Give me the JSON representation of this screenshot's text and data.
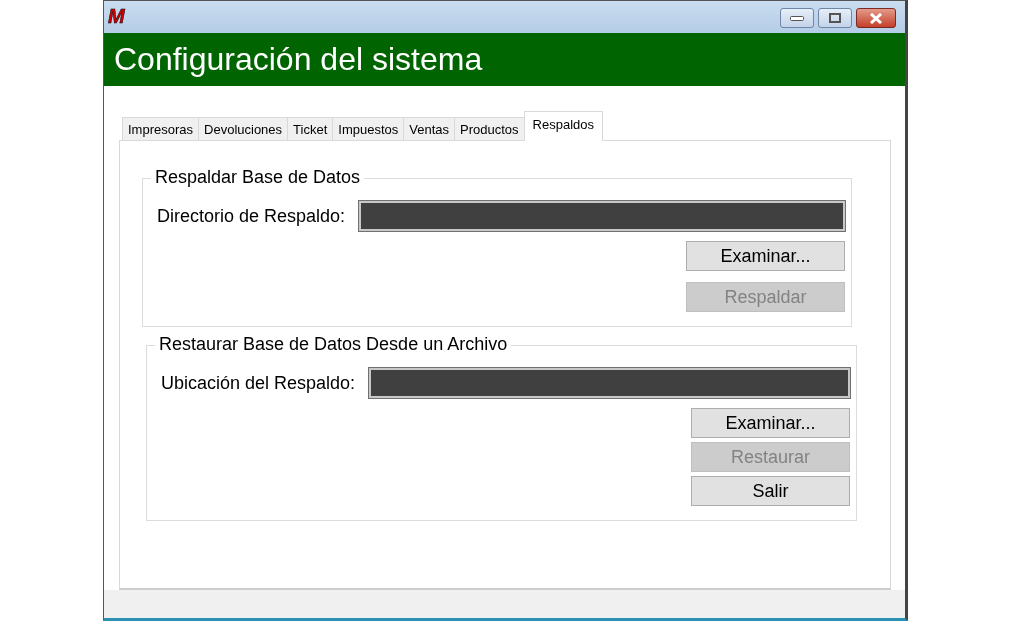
{
  "window": {
    "logo": "M",
    "title": "Configuración del sistema"
  },
  "tabs": [
    {
      "label": "Impresoras",
      "selected": false
    },
    {
      "label": "Devoluciones",
      "selected": false
    },
    {
      "label": "Ticket",
      "selected": false
    },
    {
      "label": "Impuestos",
      "selected": false
    },
    {
      "label": "Ventas",
      "selected": false
    },
    {
      "label": "Productos",
      "selected": false
    },
    {
      "label": "Respaldos",
      "selected": true
    }
  ],
  "groups": [
    {
      "legend": "Respaldar Base de Datos",
      "field_label": "Directorio de Respaldo:",
      "buttons": [
        {
          "label": "Examinar...",
          "disabled": false
        },
        {
          "label": "Respaldar",
          "disabled": true
        }
      ]
    },
    {
      "legend": "Restaurar Base de Datos Desde un Archivo",
      "field_label": "Ubicación del Respaldo:",
      "buttons": [
        {
          "label": "Examinar...",
          "disabled": false
        },
        {
          "label": "Restaurar",
          "disabled": true
        },
        {
          "label": "Salir",
          "disabled": false
        }
      ]
    }
  ]
}
